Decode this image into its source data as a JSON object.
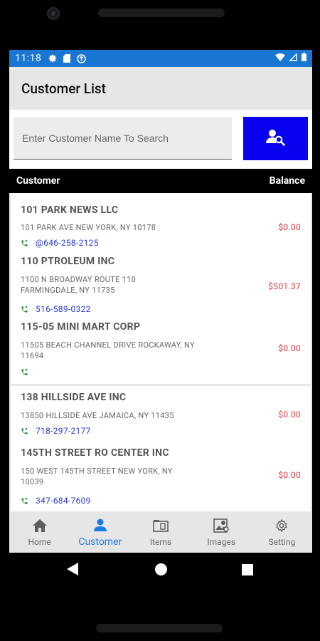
{
  "status_bar": {
    "time": "11:18",
    "left_icons": [
      "gear-icon",
      "sd-card-icon",
      "sync-icon"
    ],
    "right_icons": [
      "wifi-icon",
      "signal-icon",
      "battery-icon"
    ],
    "bg_color": "#1976d2"
  },
  "app_bar": {
    "title": "Customer List"
  },
  "search": {
    "placeholder": "Enter Customer Name To Search",
    "value": "",
    "button_icon": "search-user-icon",
    "button_color": "#0a00f0"
  },
  "columns": {
    "customer": "Customer",
    "balance": "Balance"
  },
  "customers": [
    {
      "name": "101 PARK NEWS LLC",
      "address": "101 PARK AVE NEW YORK, NY 10178",
      "phone": "@646-258-2125",
      "balance": "$0.00"
    },
    {
      "name": "110 PTROLEUM INC",
      "address": "1100 N BROADWAY ROUTE 110 FARMINGDALE, NY 11735",
      "phone": "516-589-0322",
      "balance": "$501.37"
    },
    {
      "name": "115-05 MINI MART CORP",
      "address": "11505 BEACH CHANNEL DRIVE ROCKAWAY, NY 11694",
      "phone": "",
      "balance": "$0.00"
    },
    {
      "name": "138 HILLSIDE AVE INC",
      "address": "13850 HILLSIDE AVE JAMAICA, NY 11435",
      "phone": "718-297-2177",
      "balance": "$0.00"
    },
    {
      "name": "145TH STREET RO CENTER INC",
      "address": "150 WEST 145TH STREET NEW YORK, NY 10039",
      "phone": "347-684-7609",
      "balance": "$0.00"
    }
  ],
  "tabs": [
    {
      "label": "Home",
      "icon": "home-icon",
      "active": false
    },
    {
      "label": "Customer",
      "icon": "person-icon",
      "active": true
    },
    {
      "label": "Items",
      "icon": "items-icon",
      "active": false
    },
    {
      "label": "Images",
      "icon": "images-icon",
      "active": false
    },
    {
      "label": "Setting",
      "icon": "gear-icon",
      "active": false
    }
  ],
  "nav_bar": {
    "buttons": [
      "back-icon",
      "home-circle-icon",
      "recents-icon"
    ]
  },
  "colors": {
    "accent": "#1a7ee0",
    "balance": "#e0343a",
    "phone": "#2a3bd9",
    "phone_icon": "#2e8b3a"
  }
}
